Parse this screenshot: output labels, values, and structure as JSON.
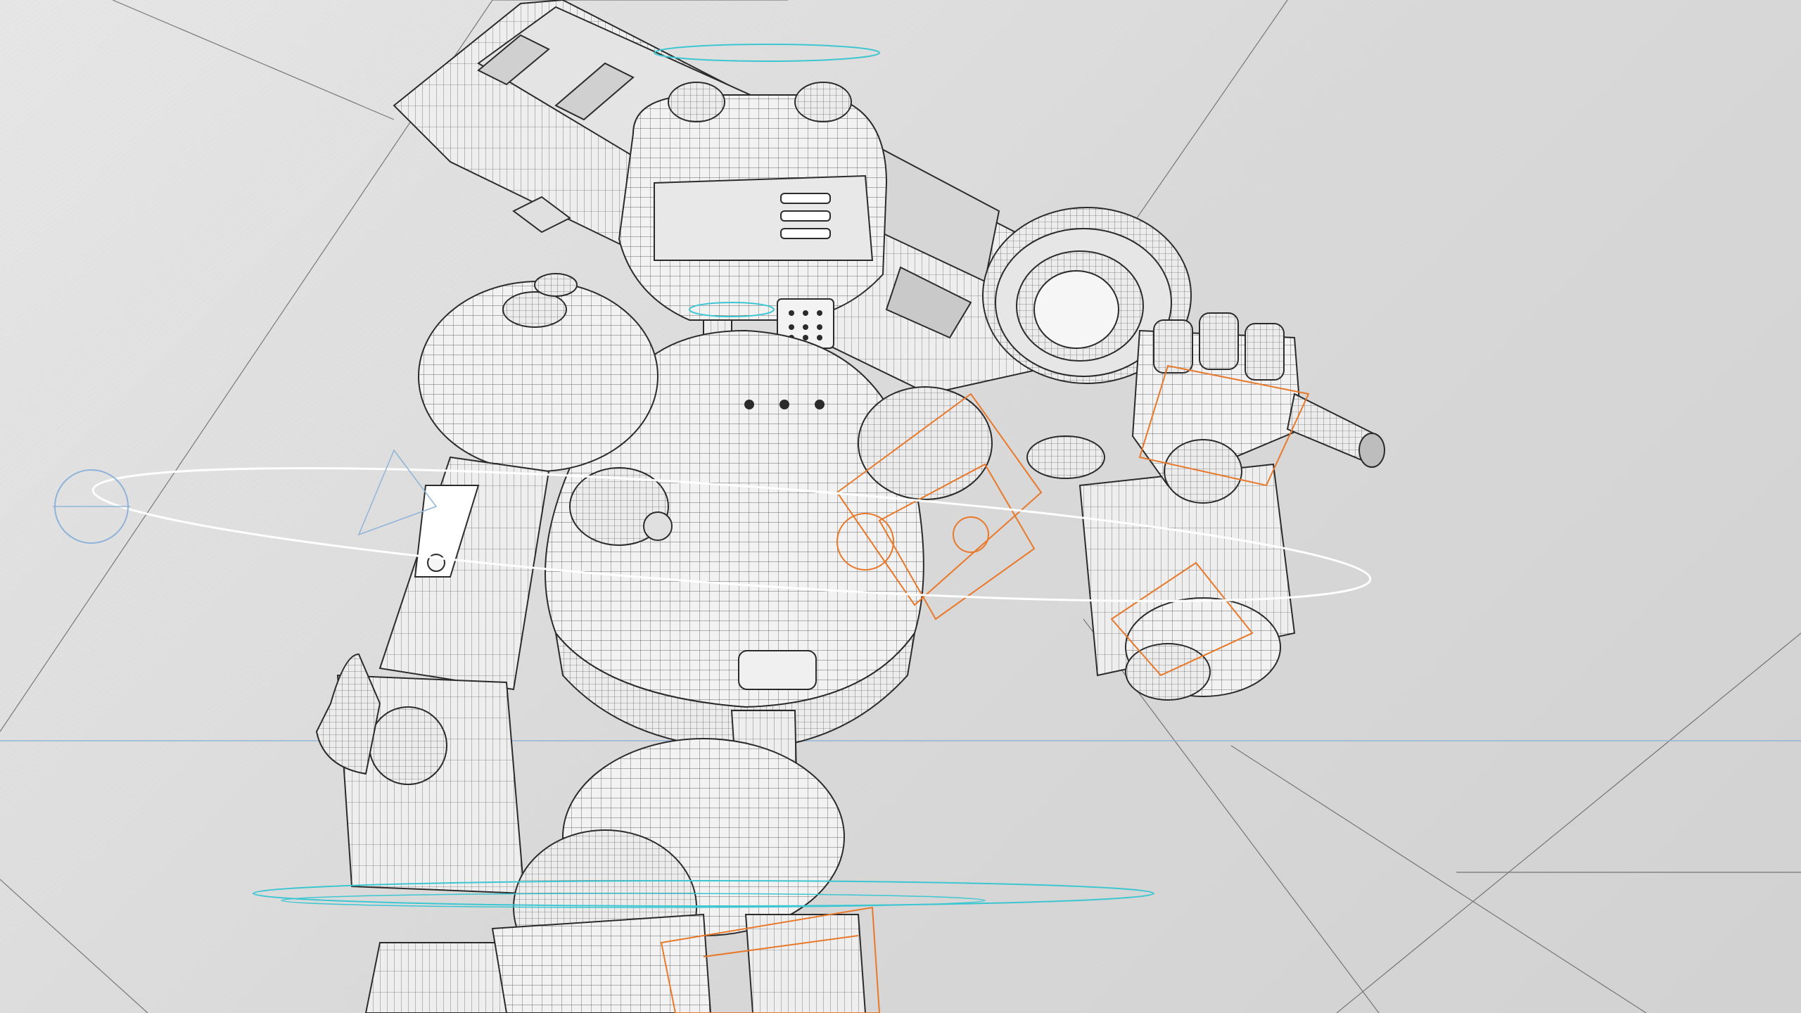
{
  "scene": {
    "subject": "robot-wireframe",
    "view_mode": "wireframe",
    "colors": {
      "background": "#dcdcdc",
      "wire": "#2b2b2b",
      "surface": "#efefef",
      "rig_orange": "#e8782a",
      "rig_cyan": "#3cc6d2",
      "rig_white": "#ffffff",
      "guide_blue": "#8fb3d9"
    }
  }
}
